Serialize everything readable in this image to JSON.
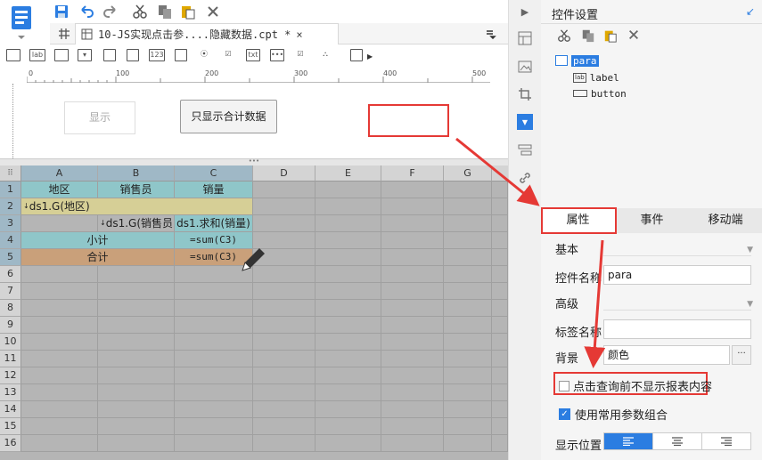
{
  "toolbar": {
    "icons": [
      "save-icon",
      "undo-icon",
      "redo-icon",
      "cut-icon",
      "copy-icon",
      "paste-icon",
      "delete-icon"
    ]
  },
  "tab": {
    "file_label": "10-JS实现点击参....隐藏数据.cpt *",
    "close": "×"
  },
  "palette": {
    "label_widget": "lab",
    "number_widget": "123",
    "text_widget": "txt"
  },
  "ruler": {
    "marks": [
      "0",
      "100",
      "200",
      "300",
      "400",
      "500"
    ]
  },
  "params": {
    "display_button": "显示",
    "sum_button": "只显示合计数据"
  },
  "grid": {
    "columns": [
      "A",
      "B",
      "C",
      "D",
      "E",
      "F",
      "G"
    ],
    "rows": [
      "1",
      "2",
      "3",
      "4",
      "5",
      "6",
      "7",
      "8",
      "9",
      "10",
      "11",
      "12",
      "13",
      "14",
      "15",
      "16"
    ],
    "cells": {
      "a1": "地区",
      "b1": "销售员",
      "c1": "销量",
      "a2": "ds1.G(地区)",
      "b3": "ds1.G(销售员)",
      "c3": "ds1.求和(销量)",
      "ab4": "小计",
      "c4": "=sum(C3)",
      "ab5": "合计",
      "c5": "=sum(C3)"
    }
  },
  "panel": {
    "title": "控件设置",
    "tree": {
      "root": "para",
      "label": "label",
      "button": "button",
      "label_icon": "lab"
    },
    "tabs": [
      "属性",
      "事件",
      "移动端"
    ],
    "basic": "基本",
    "widget_name_label": "控件名称",
    "widget_name_value": "para",
    "advanced": "高级",
    "label_name": "标签名称",
    "background_label": "背景",
    "background_value": "颜色",
    "ellipsis": "···",
    "hide_before_query": "点击查询前不显示报表内容",
    "use_common_params": "使用常用参数组合",
    "display_position": "显示位置",
    "checked_mark": "✓"
  },
  "colors": {
    "accent": "#2b7de1",
    "red": "#e53935",
    "header_yellow": "#d6cf96",
    "cell_teal": "#8fc6c9",
    "cell_orange": "#c9a07a",
    "grid_gray": "#b5b5b5"
  }
}
